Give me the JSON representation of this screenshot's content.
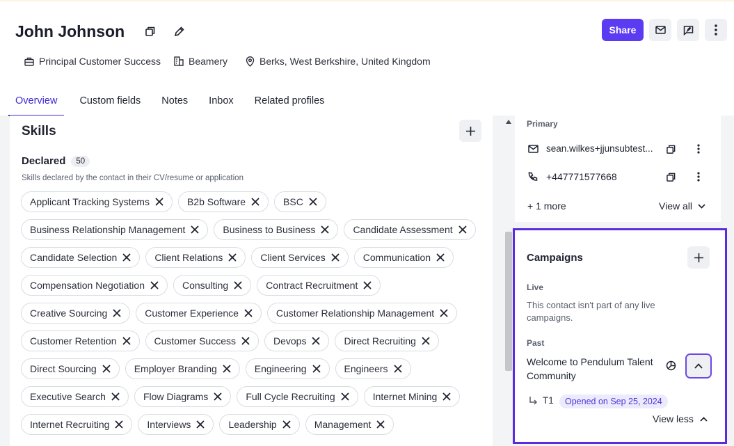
{
  "profile": {
    "name": "John Johnson",
    "job_title": "Principal Customer Success",
    "company": "Beamery",
    "location": "Berks, West Berkshire, United Kingdom"
  },
  "actions": {
    "share_label": "Share"
  },
  "tabs": [
    {
      "label": "Overview",
      "active": true
    },
    {
      "label": "Custom fields"
    },
    {
      "label": "Notes"
    },
    {
      "label": "Inbox"
    },
    {
      "label": "Related profiles"
    }
  ],
  "skills": {
    "title": "Skills",
    "declared_label": "Declared",
    "declared_count": "50",
    "declared_description": "Skills declared by the contact in their CV/resume or application",
    "rows": [
      [
        "Applicant Tracking Systems",
        "B2b Software",
        "BSC"
      ],
      [
        "Business Relationship Management",
        "Business to Business",
        "Candidate Assessment"
      ],
      [
        "Candidate Selection",
        "Client Relations",
        "Client Services",
        "Communication"
      ],
      [
        "Compensation Negotiation",
        "Consulting",
        "Contract Recruitment"
      ],
      [
        "Creative Sourcing",
        "Customer Experience",
        "Customer Relationship Management"
      ],
      [
        "Customer Retention",
        "Customer Success",
        "Devops",
        "Direct Recruiting"
      ],
      [
        "Direct Sourcing",
        "Employer Branding",
        "Engineering",
        "Engineers"
      ],
      [
        "Executive Search",
        "Flow Diagrams",
        "Full Cycle Recruiting",
        "Internet Mining"
      ],
      [
        "Internet Recruiting",
        "Interviews",
        "Leadership",
        "Management"
      ]
    ]
  },
  "contact": {
    "primary_label": "Primary",
    "email": "sean.wilkes+jjunsubtest...",
    "phone": "+447771577668",
    "more_label": "+ 1 more",
    "view_all_label": "View all"
  },
  "campaigns": {
    "title": "Campaigns",
    "live_label": "Live",
    "live_empty_line1": "This contact isn't part of any live",
    "live_empty_line2": "campaigns.",
    "past_label": "Past",
    "past_name_line1": "Welcome to Pendulum Talent",
    "past_name_line2": "Community",
    "step_label": "T1",
    "opened_label": "Opened on Sep 25, 2024",
    "view_less_label": "View less"
  },
  "colors": {
    "accent": "#5b3cf2",
    "tab_active": "#3d2bd4",
    "highlight_border": "#5b2be0"
  }
}
